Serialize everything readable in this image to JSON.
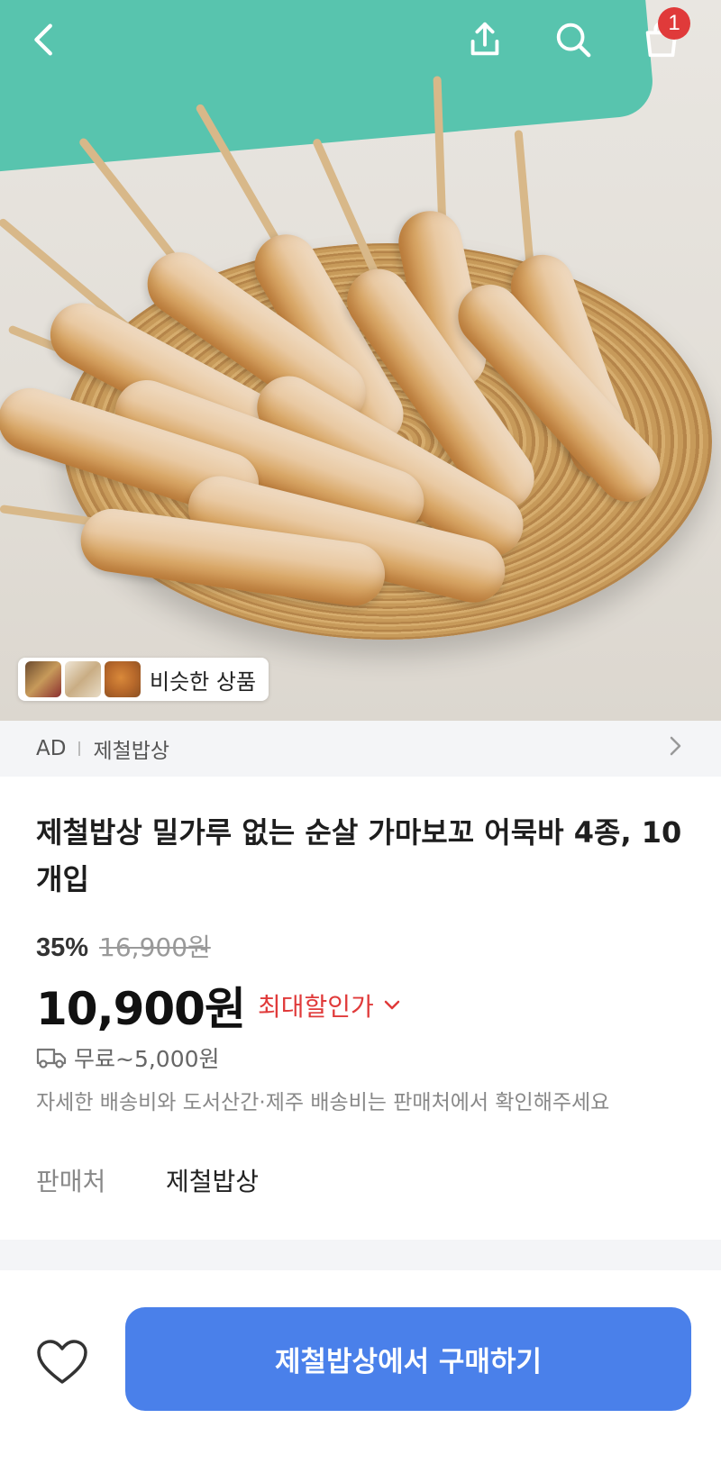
{
  "header": {
    "back_icon": "chevron-left-icon",
    "share_icon": "share-icon",
    "search_icon": "search-icon",
    "cart_icon": "shopping-bag-icon",
    "cart_count": "1"
  },
  "hero": {
    "similar_label": "비슷한 상품"
  },
  "ad": {
    "tag": "AD",
    "brand": "제철밥상"
  },
  "product": {
    "title": "제철밥상 밀가루 없는 순살 가마보꼬 어묵바 4종, 10개입",
    "discount_rate": "35%",
    "original_price": "16,900원",
    "price": "10,900원",
    "max_discount_label": "최대할인가",
    "shipping": "무료~5,000원",
    "shipping_note": "자세한 배송비와 도서산간·제주 배송비는 판매처에서 확인해주세요",
    "seller_label": "판매처",
    "seller_name": "제철밥상"
  },
  "footer": {
    "buy_label": "제철밥상에서 구매하기",
    "wishlist_icon": "heart-icon"
  },
  "colors": {
    "accent": "#4a80ea",
    "sale_red": "#e03a3a",
    "badge": "#e03a3a"
  }
}
